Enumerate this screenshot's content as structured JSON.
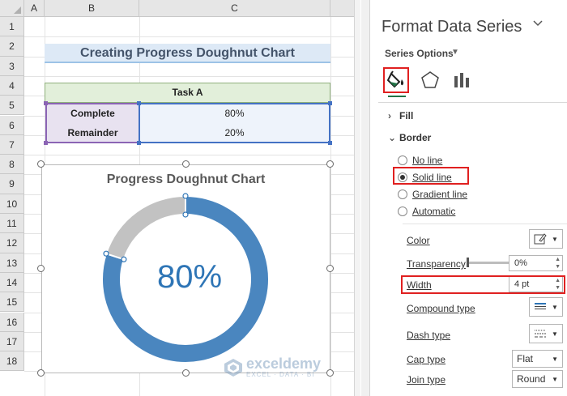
{
  "spreadsheet": {
    "columns": [
      "A",
      "B",
      "C"
    ],
    "rows": [
      "1",
      "2",
      "3",
      "4",
      "5",
      "6",
      "7",
      "8",
      "9",
      "10",
      "11",
      "12",
      "13",
      "14",
      "15",
      "16",
      "17",
      "18"
    ],
    "title": "Creating Progress Doughnut Chart",
    "table": {
      "header": "Task A",
      "rows": [
        {
          "label": "Complete",
          "value": "80%"
        },
        {
          "label": "Remainder",
          "value": "20%"
        }
      ]
    }
  },
  "chart": {
    "title": "Progress Doughnut Chart",
    "center_label": "80%"
  },
  "chart_data": {
    "type": "pie",
    "subtype": "doughnut",
    "title": "Progress Doughnut Chart",
    "categories": [
      "Complete",
      "Remainder"
    ],
    "values": [
      80,
      20
    ],
    "colors": [
      "#4a86bf",
      "#c2c2c2"
    ],
    "center_label": "80%"
  },
  "watermark": {
    "name": "exceldemy",
    "tagline": "EXCEL · DATA · BI"
  },
  "format_pane": {
    "title": "Format Data Series",
    "collapse_icon": "chevron-down-icon",
    "options_label": "Series Options",
    "tabs": [
      {
        "name": "Fill & Line",
        "icon": "paint-bucket-icon",
        "active": true
      },
      {
        "name": "Effects",
        "icon": "pentagon-icon",
        "active": false
      },
      {
        "name": "Series Options",
        "icon": "bar-chart-icon",
        "active": false
      }
    ],
    "sections": {
      "fill": "Fill",
      "border": "Border"
    },
    "border_options": [
      {
        "label": "No line",
        "selected": false
      },
      {
        "label": "Solid line",
        "selected": true
      },
      {
        "label": "Gradient line",
        "selected": false
      },
      {
        "label": "Automatic",
        "selected": false
      }
    ],
    "properties": {
      "color_label": "Color",
      "transparency_label": "Transparency",
      "transparency_value": "0%",
      "width_label": "Width",
      "width_value": "4 pt",
      "compound_label": "Compound type",
      "dash_label": "Dash type",
      "cap_label": "Cap type",
      "cap_value": "Flat",
      "join_label": "Join type",
      "join_value": "Round"
    },
    "accent_color": "#e02020"
  }
}
